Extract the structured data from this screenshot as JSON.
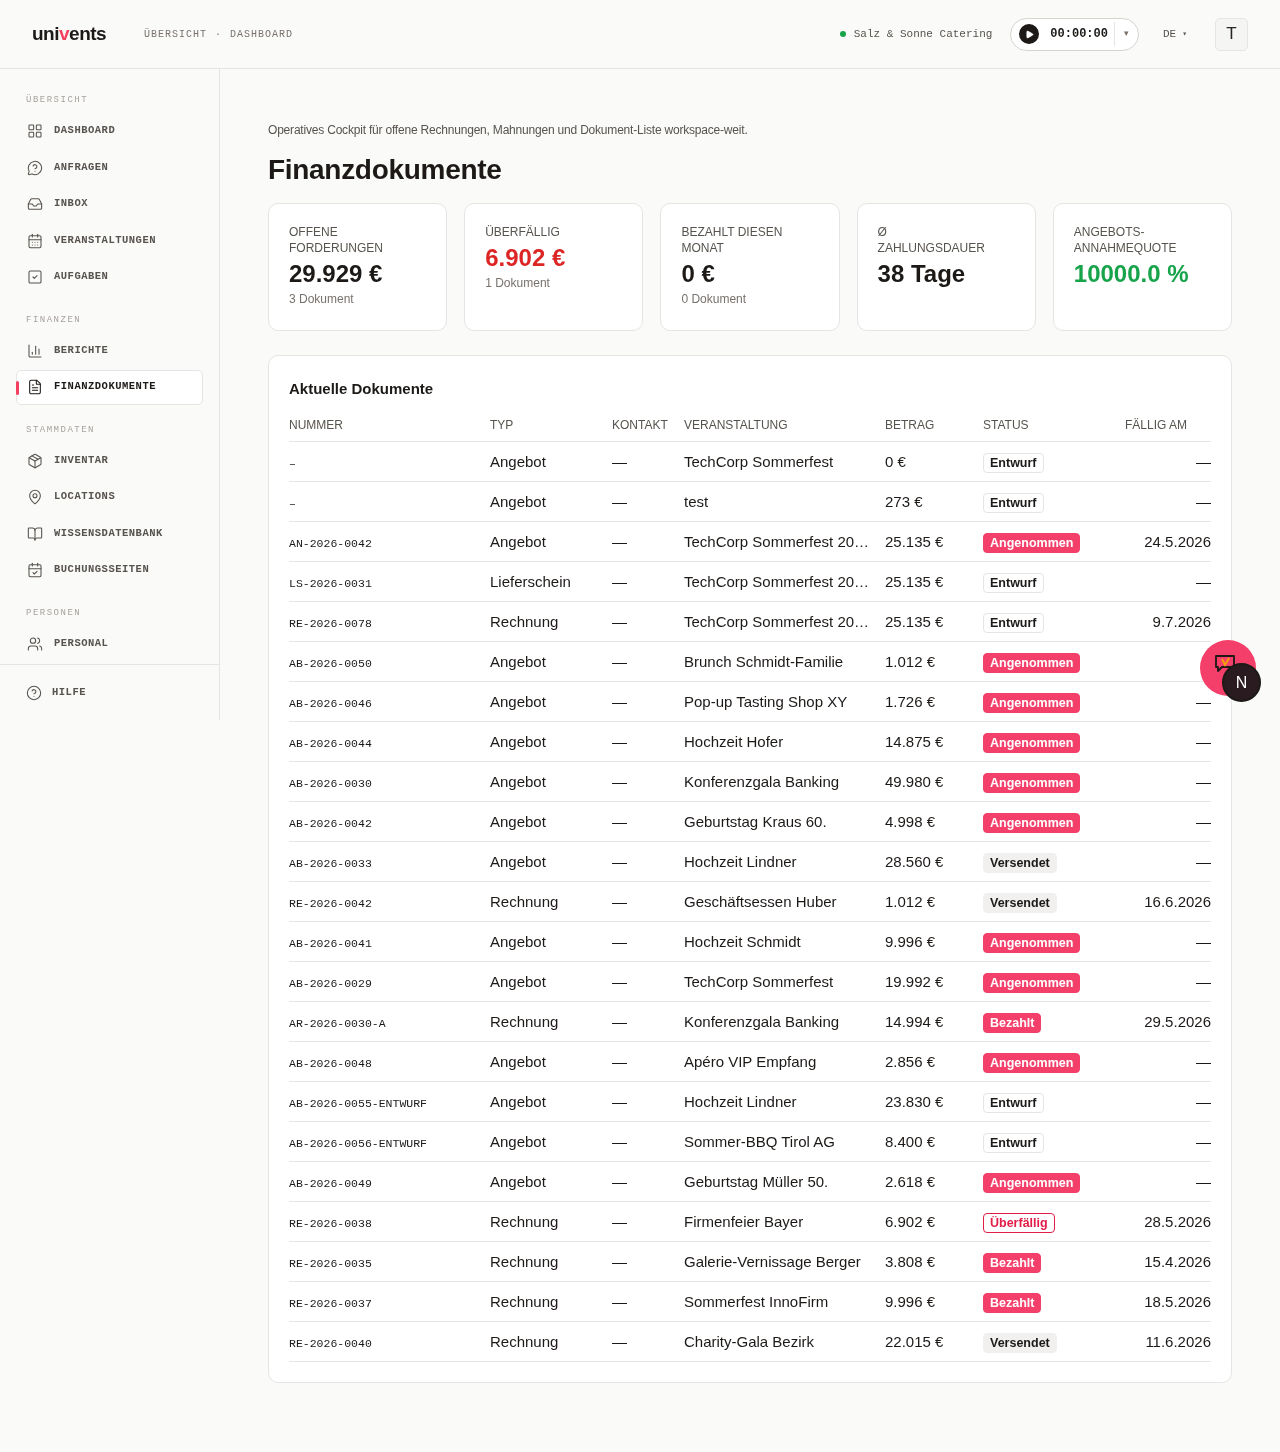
{
  "header": {
    "logo": {
      "before": "uni",
      "accent": "v",
      "after": "ents"
    },
    "breadcrumb": [
      "ÜBERSICHT",
      "·",
      "DASHBOARD"
    ],
    "workspace": {
      "name": "Salz & Sonne Catering",
      "online": true
    },
    "timer": {
      "time": "00:00:00",
      "caret": "▾"
    },
    "language": {
      "code": "DE",
      "caret": "▾"
    },
    "avatar": "T"
  },
  "sidebar": {
    "sections": [
      {
        "title": "ÜBERSICHT",
        "items": [
          {
            "label": "DASHBOARD",
            "selected": false
          },
          {
            "label": "ANFRAGEN",
            "selected": false
          },
          {
            "label": "INBOX",
            "selected": false
          },
          {
            "label": "VERANSTALTUNGEN",
            "selected": false
          },
          {
            "label": "AUFGABEN",
            "selected": false
          }
        ]
      },
      {
        "title": "FINANZEN",
        "items": [
          {
            "label": "BERICHTE",
            "selected": false
          },
          {
            "label": "FINANZDOKUMENTE",
            "selected": true
          }
        ]
      },
      {
        "title": "STAMMDATEN",
        "items": [
          {
            "label": "INVENTAR",
            "selected": false
          },
          {
            "label": "LOCATIONS",
            "selected": false
          },
          {
            "label": "WISSENSDATENBANK",
            "selected": false
          },
          {
            "label": "BUCHUNGSSEITEN",
            "selected": false
          }
        ]
      },
      {
        "title": "PERSONEN",
        "items": [
          {
            "label": "PERSONAL",
            "selected": false
          }
        ]
      }
    ],
    "footer": {
      "label": "HILFE"
    }
  },
  "page": {
    "subtitle": "Operatives Cockpit für offene Rechnungen, Mahnungen und Dokument-Liste workspace-weit.",
    "title": "Finanzdokumente"
  },
  "stats": [
    {
      "label": "OFFENE FORDERUNGEN",
      "value": "29.929 €",
      "kind": "neutral",
      "note": "3 Dokument"
    },
    {
      "label": "ÜBERFÄLLIG",
      "value": "6.902 €",
      "kind": "overdue",
      "note": "1 Dokument"
    },
    {
      "label": "BEZAHLT DIESEN MONAT",
      "value": "0 €",
      "kind": "neutral",
      "note": "0 Dokument"
    },
    {
      "label": "Ø ZAHLUNGSDAUER",
      "value": "38 Tage",
      "kind": "neutral"
    },
    {
      "label": "ANGEBOTS-ANNAHMEQUOTE",
      "value": "10000.0 %",
      "kind": "positive"
    }
  ],
  "table": {
    "title": "Aktuelle Dokumente",
    "columns": [
      "NUMMER",
      "TYP",
      "KONTAKT",
      "VERANSTALTUNG",
      "BETRAG",
      "STATUS",
      "FÄLLIG AM"
    ],
    "rows": [
      {
        "number": "–",
        "type": "Angebot",
        "contact": "—",
        "event": "TechCorp Sommerfest",
        "amount": "0 €",
        "status": {
          "label": "Entwurf",
          "kind": "draft"
        },
        "due": "—"
      },
      {
        "number": "–",
        "type": "Angebot",
        "contact": "—",
        "event": "test",
        "amount": "273 €",
        "status": {
          "label": "Entwurf",
          "kind": "draft"
        },
        "due": "—"
      },
      {
        "number": "AN-2026-0042",
        "type": "Angebot",
        "contact": "—",
        "event": "TechCorp Sommerfest 20…",
        "amount": "25.135 €",
        "status": {
          "label": "Angenommen",
          "kind": "accepted"
        },
        "due": "24.5.2026"
      },
      {
        "number": "LS-2026-0031",
        "type": "Lieferschein",
        "contact": "—",
        "event": "TechCorp Sommerfest 20…",
        "amount": "25.135 €",
        "status": {
          "label": "Entwurf",
          "kind": "draft"
        },
        "due": "—"
      },
      {
        "number": "RE-2026-0078",
        "type": "Rechnung",
        "contact": "—",
        "event": "TechCorp Sommerfest 20…",
        "amount": "25.135 €",
        "status": {
          "label": "Entwurf",
          "kind": "draft"
        },
        "due": "9.7.2026"
      },
      {
        "number": "AB-2026-0050",
        "type": "Angebot",
        "contact": "—",
        "event": "Brunch Schmidt-Familie",
        "amount": "1.012 €",
        "status": {
          "label": "Angenommen",
          "kind": "accepted"
        }
      },
      {
        "number": "AB-2026-0046",
        "type": "Angebot",
        "contact": "—",
        "event": "Pop-up Tasting Shop XY",
        "amount": "1.726 €",
        "status": {
          "label": "Angenommen",
          "kind": "accepted"
        },
        "due": "—"
      },
      {
        "number": "AB-2026-0044",
        "type": "Angebot",
        "contact": "—",
        "event": "Hochzeit Hofer",
        "amount": "14.875 €",
        "status": {
          "label": "Angenommen",
          "kind": "accepted"
        },
        "due": "—"
      },
      {
        "number": "AB-2026-0030",
        "type": "Angebot",
        "contact": "—",
        "event": "Konferenzgala Banking",
        "amount": "49.980 €",
        "status": {
          "label": "Angenommen",
          "kind": "accepted"
        },
        "due": "—"
      },
      {
        "number": "AB-2026-0042",
        "type": "Angebot",
        "contact": "—",
        "event": "Geburtstag Kraus 60.",
        "amount": "4.998 €",
        "status": {
          "label": "Angenommen",
          "kind": "accepted"
        },
        "due": "—"
      },
      {
        "number": "AB-2026-0033",
        "type": "Angebot",
        "contact": "—",
        "event": "Hochzeit Lindner",
        "amount": "28.560 €",
        "status": {
          "label": "Versendet",
          "kind": "sent"
        },
        "due": "—"
      },
      {
        "number": "RE-2026-0042",
        "type": "Rechnung",
        "contact": "—",
        "event": "Geschäftsessen Huber",
        "amount": "1.012 €",
        "status": {
          "label": "Versendet",
          "kind": "sent"
        },
        "due": "16.6.2026"
      },
      {
        "number": "AB-2026-0041",
        "type": "Angebot",
        "contact": "—",
        "event": "Hochzeit Schmidt",
        "amount": "9.996 €",
        "status": {
          "label": "Angenommen",
          "kind": "accepted"
        },
        "due": "—"
      },
      {
        "number": "AB-2026-0029",
        "type": "Angebot",
        "contact": "—",
        "event": "TechCorp Sommerfest",
        "amount": "19.992 €",
        "status": {
          "label": "Angenommen",
          "kind": "accepted"
        },
        "due": "—"
      },
      {
        "number": "AR-2026-0030-A",
        "type": "Rechnung",
        "contact": "—",
        "event": "Konferenzgala Banking",
        "amount": "14.994 €",
        "status": {
          "label": "Bezahlt",
          "kind": "paid"
        },
        "due": "29.5.2026"
      },
      {
        "number": "AB-2026-0048",
        "type": "Angebot",
        "contact": "—",
        "event": "Apéro VIP Empfang",
        "amount": "2.856 €",
        "status": {
          "label": "Angenommen",
          "kind": "accepted"
        },
        "due": "—"
      },
      {
        "number": "AB-2026-0055-ENTWURF",
        "type": "Angebot",
        "contact": "—",
        "event": "Hochzeit Lindner",
        "amount": "23.830 €",
        "status": {
          "label": "Entwurf",
          "kind": "draft"
        },
        "due": "—"
      },
      {
        "number": "AB-2026-0056-ENTWURF",
        "type": "Angebot",
        "contact": "—",
        "event": "Sommer-BBQ Tirol AG",
        "amount": "8.400 €",
        "status": {
          "label": "Entwurf",
          "kind": "draft"
        },
        "due": "—"
      },
      {
        "number": "AB-2026-0049",
        "type": "Angebot",
        "contact": "—",
        "event": "Geburtstag Müller 50.",
        "amount": "2.618 €",
        "status": {
          "label": "Angenommen",
          "kind": "accepted"
        },
        "due": "—"
      },
      {
        "number": "RE-2026-0038",
        "type": "Rechnung",
        "contact": "—",
        "event": "Firmenfeier Bayer",
        "amount": "6.902 €",
        "status": {
          "label": "Überfällig",
          "kind": "overdue"
        },
        "due": "28.5.2026"
      },
      {
        "number": "RE-2026-0035",
        "type": "Rechnung",
        "contact": "—",
        "event": "Galerie-Vernissage Berger",
        "amount": "3.808 €",
        "status": {
          "label": "Bezahlt",
          "kind": "paid"
        },
        "due": "15.4.2026"
      },
      {
        "number": "RE-2026-0037",
        "type": "Rechnung",
        "contact": "—",
        "event": "Sommerfest InnoFirm",
        "amount": "9.996 €",
        "status": {
          "label": "Bezahlt",
          "kind": "paid"
        },
        "due": "18.5.2026"
      },
      {
        "number": "RE-2026-0040",
        "type": "Rechnung",
        "contact": "—",
        "event": "Charity-Gala Bezirk",
        "amount": "22.015 €",
        "status": {
          "label": "Versendet",
          "kind": "sent"
        },
        "due": "11.6.2026"
      }
    ]
  },
  "floating": {
    "badge": "N"
  }
}
